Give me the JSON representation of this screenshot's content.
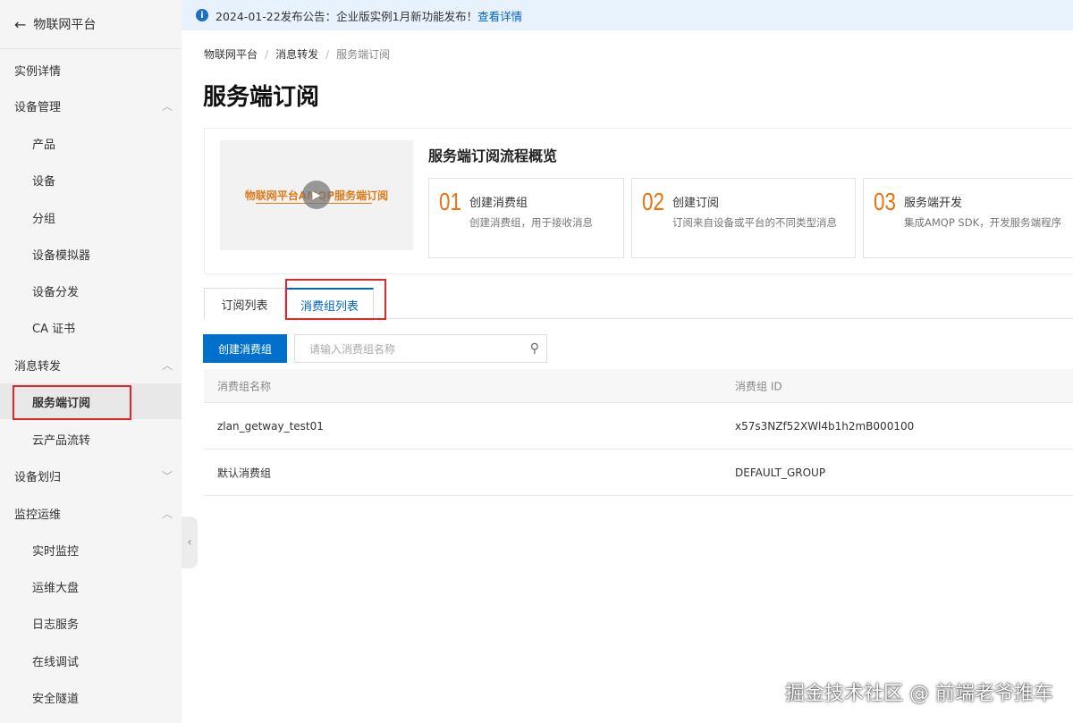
{
  "sidebar": {
    "back_label": "物联网平台",
    "items": [
      {
        "label": "实例详情"
      },
      {
        "label": "设备管理"
      },
      {
        "label": "产品"
      },
      {
        "label": "设备"
      },
      {
        "label": "分组"
      },
      {
        "label": "设备模拟器"
      },
      {
        "label": "设备分发"
      },
      {
        "label": "CA 证书"
      },
      {
        "label": "消息转发"
      },
      {
        "label": "服务端订阅"
      },
      {
        "label": "云产品流转"
      },
      {
        "label": "设备划归"
      },
      {
        "label": "监控运维"
      },
      {
        "label": "实时监控"
      },
      {
        "label": "运维大盘"
      },
      {
        "label": "日志服务"
      },
      {
        "label": "在线调试"
      },
      {
        "label": "安全隧道"
      }
    ]
  },
  "notice": {
    "text": "2024-01-22发布公告：企业版实例1月新功能发布！",
    "link": "查看详情"
  },
  "breadcrumb": [
    "物联网平台",
    "消息转发",
    "服务端订阅"
  ],
  "page_title": "服务端订阅",
  "overview": {
    "video_label": "物联网平台AMQP服务端订阅",
    "title": "服务端订阅流程概览",
    "steps": [
      {
        "num": "01",
        "title": "创建消费组",
        "desc": "创建消费组，用于接收消息"
      },
      {
        "num": "02",
        "title": "创建订阅",
        "desc": "订阅来自设备或平台的不同类型消息"
      },
      {
        "num": "03",
        "title": "服务端开发",
        "desc": "集成AMQP SDK，开发服务端程序"
      }
    ]
  },
  "tabs": [
    {
      "label": "订阅列表"
    },
    {
      "label": "消费组列表"
    }
  ],
  "toolbar": {
    "create_label": "创建消费组",
    "search_placeholder": "请输入消费组名称"
  },
  "table": {
    "headers": [
      "消费组名称",
      "消费组 ID"
    ],
    "rows": [
      [
        "zlan_getway_test01",
        "x57s3NZf52XWl4b1h2mB000100"
      ],
      [
        "默认消费组",
        "DEFAULT_GROUP"
      ]
    ]
  },
  "watermark": "掘金技术社区 @ 前端老爷推车"
}
